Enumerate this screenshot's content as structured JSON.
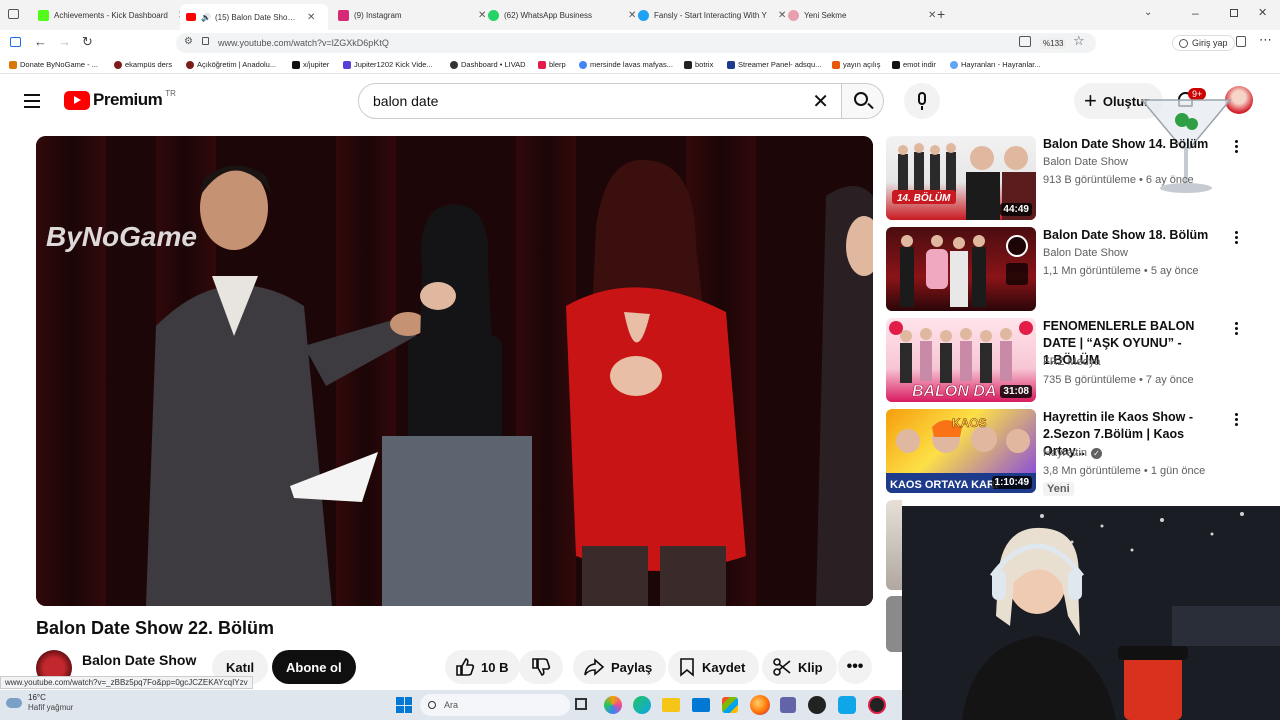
{
  "browser": {
    "tabs": [
      {
        "title": "Achievements - Kick Dashboard",
        "color": "#53fc18"
      },
      {
        "title": "(15) Balon Date Show 22. Bölüm",
        "color": "#ff0000"
      },
      {
        "title": "(9) Instagram",
        "color": "#d62976"
      },
      {
        "title": "(62) WhatsApp Business",
        "color": "#25d366"
      },
      {
        "title": "Fansly - Start Interacting With Y",
        "color": "#1da1f2"
      },
      {
        "title": "Yeni Sekme",
        "color": "#e8a0b0"
      }
    ],
    "new_tab": "+",
    "url": "www.youtube.com/watch?v=lZGXkD6pKtQ",
    "zoom": "%133",
    "signin": "Giriş yap",
    "bookmarks": [
      "Donate ByNoGame - ...",
      "ekampüs ders",
      "Açıköğretim | Anadolu...",
      "x/jupiter",
      "Jupiter1202 Kick Vide...",
      "Dashboard • LIVAD",
      "blerp",
      "mersinde lavas mafyas...",
      "botrix",
      "Streamer Panel- adsqu...",
      "yayın açılış",
      "emot indir",
      "Hayranları - Hayranlar..."
    ]
  },
  "youtube": {
    "logo": "Premium",
    "logo_sup": "TR",
    "search_value": "balon date",
    "create_label": "Oluştur",
    "notif_badge": "9+"
  },
  "player": {
    "watermark": "ByNoGame"
  },
  "video": {
    "title": "Balon Date Show 22. Bölüm",
    "channel": "Balon Date Show",
    "join": "Katıl",
    "subscribe": "Abone ol",
    "likes": "10 B",
    "share": "Paylaş",
    "save": "Kaydet",
    "clip": "Klip"
  },
  "related": [
    {
      "title": "Balon Date Show 14. Bölüm",
      "channel": "Balon Date Show",
      "views": "913 B görüntüleme",
      "age": "6 ay önce",
      "duration": "44:49",
      "thumb_label": "14. BÖLÜM"
    },
    {
      "title": "Balon Date Show 18. Bölüm",
      "channel": "Balon Date Show",
      "views": "1,1 Mn görüntüleme",
      "age": "5 ay önce",
      "duration": ""
    },
    {
      "title": "FENOMENLERLE BALON DATE | “AŞK OYUNU” - 1.BÖLÜM",
      "channel": "FRZ Medya",
      "views": "735 B görüntüleme",
      "age": "7 ay önce",
      "duration": "31:08",
      "thumb_label": "BALON DA"
    },
    {
      "title": "Hayrettin ile Kaos Show - 2.Sezon 7.Bölüm | Kaos Ortay...",
      "channel": "Hayrettin",
      "views": "3,8 Mn görüntüleme",
      "age": "1 gün önce",
      "duration": "1:10:49",
      "badge": "Yeni",
      "thumb_label": "KAOS ORTAYA KARI"
    }
  ],
  "status_url": "www.youtube.com/watch?v=_zBBz5pq7Fo&pp=0gcJCZEKAYcqIYzv",
  "taskbar": {
    "temp": "16°C",
    "weather": "Hafif yağmur",
    "search": "Ara"
  }
}
